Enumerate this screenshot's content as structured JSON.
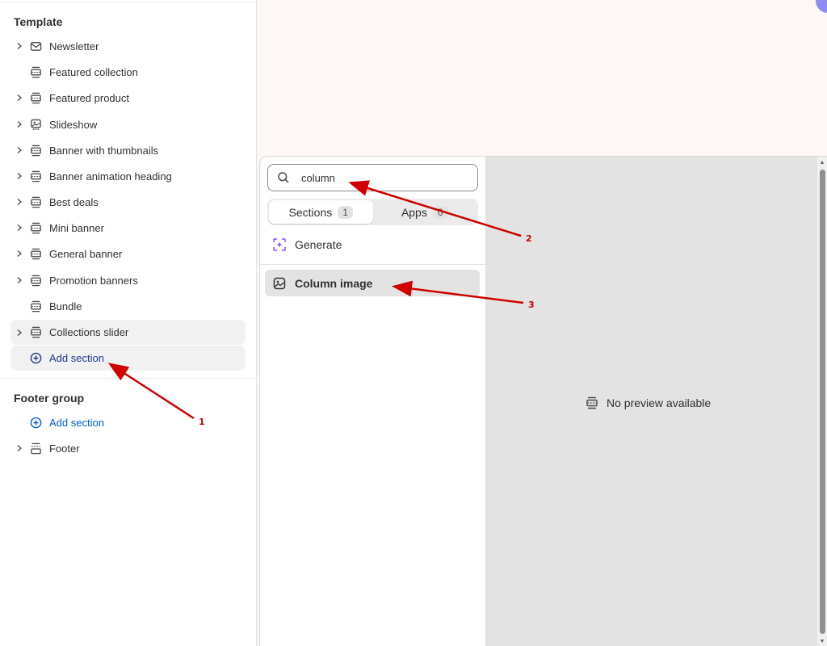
{
  "sidebar": {
    "template_title": "Template",
    "items": [
      {
        "label": "Newsletter",
        "icon": "envelope-icon",
        "chevron": true
      },
      {
        "label": "Featured collection",
        "icon": "section-icon",
        "chevron": false
      },
      {
        "label": "Featured product",
        "icon": "section-icon",
        "chevron": true
      },
      {
        "label": "Slideshow",
        "icon": "slideshow-icon",
        "chevron": true
      },
      {
        "label": "Banner with thumbnails",
        "icon": "section-icon",
        "chevron": true
      },
      {
        "label": "Banner animation heading",
        "icon": "section-icon",
        "chevron": true
      },
      {
        "label": "Best deals",
        "icon": "section-icon",
        "chevron": true
      },
      {
        "label": "Mini banner",
        "icon": "section-icon",
        "chevron": true
      },
      {
        "label": "General banner",
        "icon": "section-icon",
        "chevron": true
      },
      {
        "label": "Promotion banners",
        "icon": "section-icon",
        "chevron": true
      },
      {
        "label": "Bundle",
        "icon": "section-icon",
        "chevron": false
      },
      {
        "label": "Collections slider",
        "icon": "section-icon",
        "chevron": true
      }
    ],
    "add_section_label": "Add section",
    "footer_group_title": "Footer group",
    "footer_add_section_label": "Add section",
    "footer_item_label": "Footer"
  },
  "picker": {
    "search_value": "column",
    "tabs": [
      {
        "label": "Sections",
        "count": "1"
      },
      {
        "label": "Apps",
        "count": "0"
      }
    ],
    "generate_label": "Generate",
    "result_label": "Column image"
  },
  "preview": {
    "empty_text": "No preview available"
  },
  "annotations": [
    "1",
    "2",
    "3"
  ],
  "colors": {
    "link": "#005bd3",
    "annotation": "#d00000",
    "generate_icon": "#8051ff",
    "avatar": "#8b8ef0"
  }
}
